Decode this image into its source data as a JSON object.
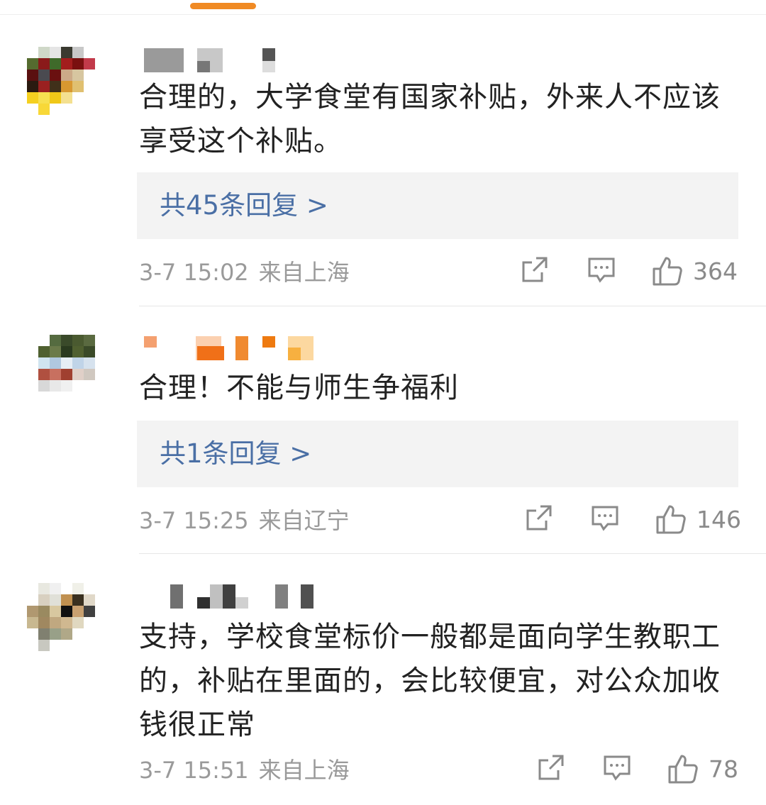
{
  "comments": [
    {
      "text": "合理的，大学食堂有国家补贴，外来人不应该享受这个补贴。",
      "reply_link": "共45条回复 >",
      "time": "3-7 15:02",
      "location": "来自上海",
      "likes": "364"
    },
    {
      "text": "合理！不能与师生争福利",
      "reply_link": "共1条回复 >",
      "time": "3-7 15:25",
      "location": "来自辽宁",
      "likes": "146"
    },
    {
      "text": "支持，学校食堂标价一般都是面向学生教职工的，补贴在里面的，会比较便宜，对公众加收钱很正常",
      "time": "3-7 15:51",
      "location": "来自上海",
      "likes": "78"
    }
  ],
  "icons": {
    "share": "share-icon",
    "comment": "comment-icon",
    "like": "thumbs-up-icon"
  },
  "colors": {
    "link": "#4a6fa5",
    "meta": "#9a9a9a",
    "accent": "#f08a24"
  }
}
